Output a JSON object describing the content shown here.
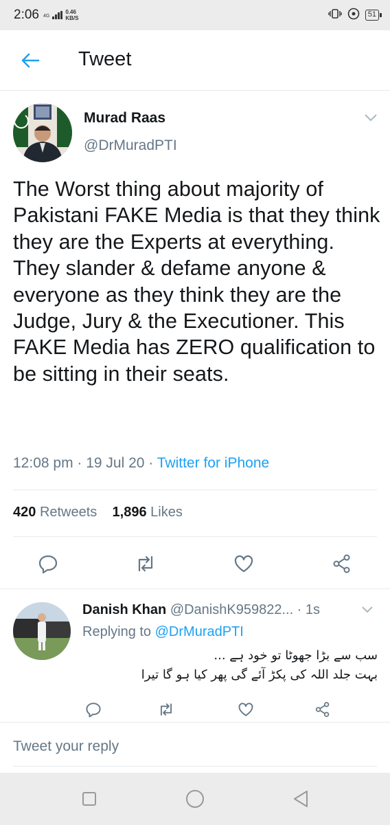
{
  "status_bar": {
    "time": "2:06",
    "network": "4G",
    "speed_value": "0.46",
    "speed_unit": "KB/S",
    "battery": "51",
    "icons": [
      "vibrate-icon",
      "wifi-hotspot-icon",
      "battery-icon"
    ]
  },
  "header": {
    "back_icon": "arrow-left-icon",
    "title": "Tweet"
  },
  "tweet": {
    "author_name": "Murad Raas",
    "author_handle": "@DrMuradPTI",
    "text": "The Worst thing about majority of Pakistani FAKE Media is that they think they are the Experts at everything. They slander & defame anyone & everyone as they think they are the Judge, Jury & the Executioner. This FAKE Media has ZERO qualification to be sitting in their seats.",
    "time": "12:08 pm",
    "date": "19 Jul 20",
    "source": "Twitter for iPhone",
    "retweets_count": "420",
    "retweets_label": "Retweets",
    "likes_count": "1,896",
    "likes_label": "Likes"
  },
  "reply": {
    "author_name": "Danish Khan",
    "author_handle": "@DanishK959822...",
    "age": "1s",
    "replying_prefix": "Replying to",
    "replying_to": "@DrMuradPTI",
    "text_line1": "سب سے بڑا جھوٹا تو خود ہے ...",
    "text_line2": "بہت جلد اللہ کی پکڑ آئے گی پھر کیا ہو گا تیرا"
  },
  "compose": {
    "placeholder": "Tweet your reply"
  },
  "colors": {
    "accent": "#1da1f2",
    "text_primary": "#14171a",
    "text_secondary": "#657786",
    "divider": "#e6ecf0",
    "system_bar": "#ececec"
  }
}
